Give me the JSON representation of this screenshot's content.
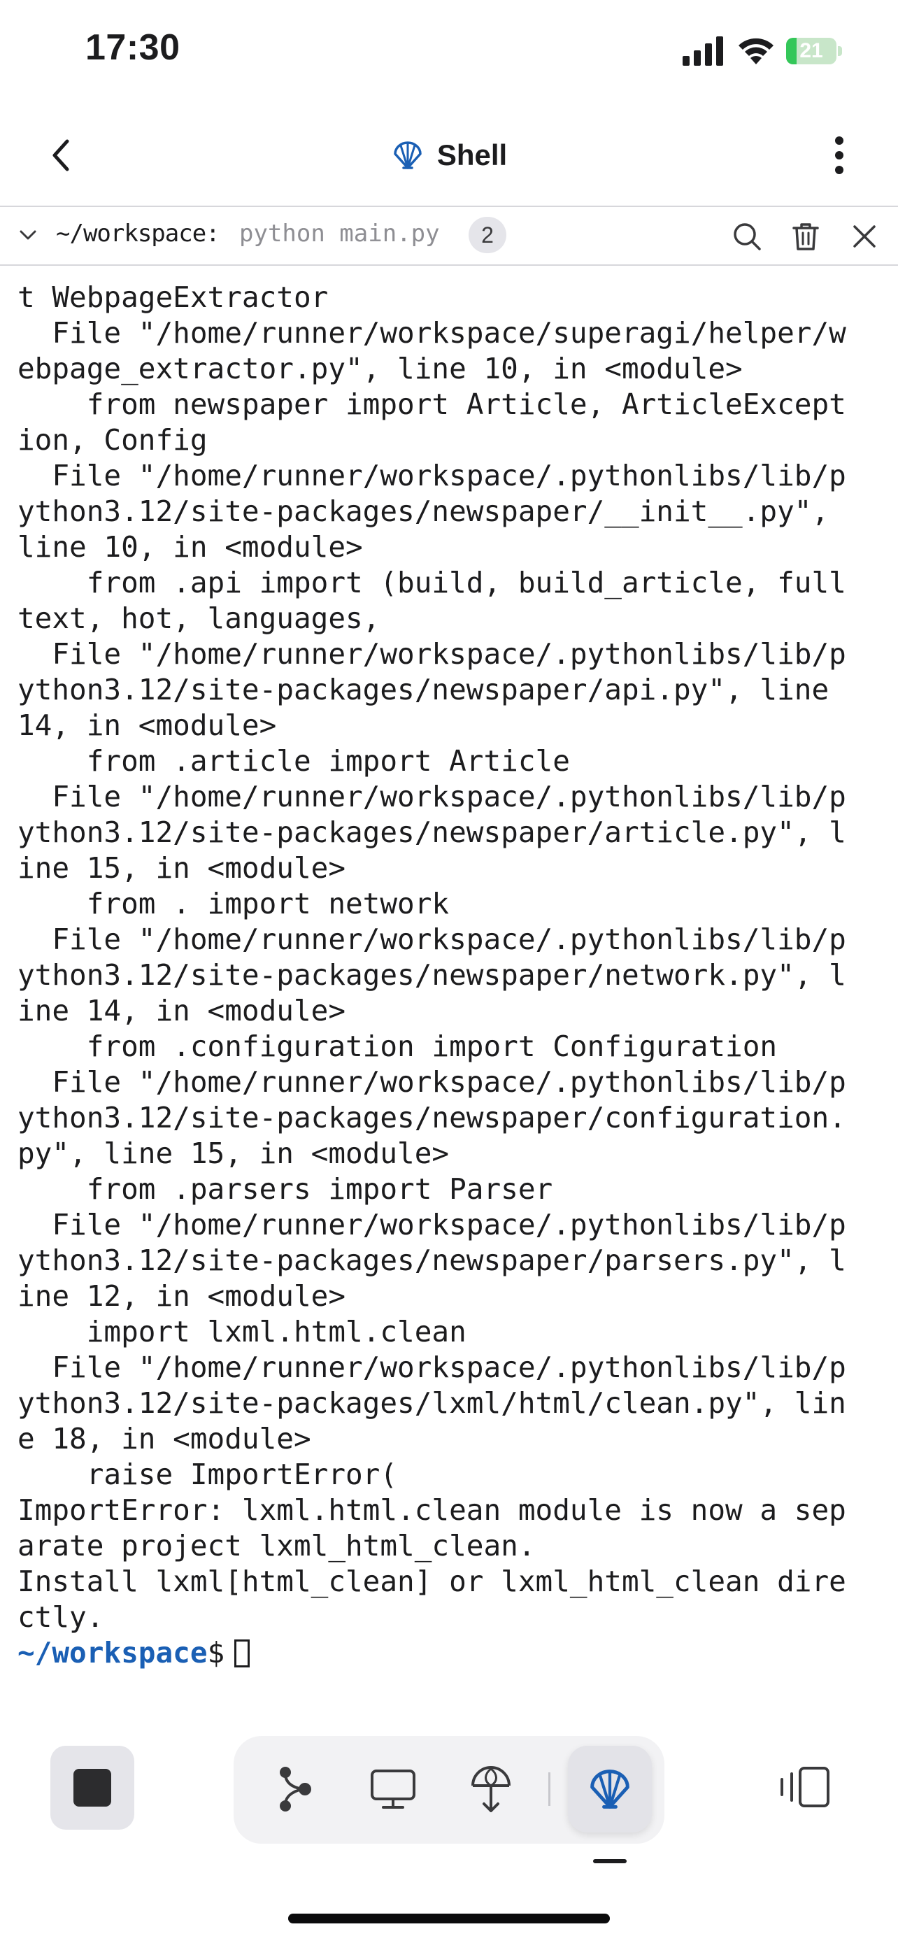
{
  "status_bar": {
    "time": "17:30",
    "battery_level": "21",
    "battery_fraction": 0.21
  },
  "header": {
    "title": "Shell",
    "back_icon": "chevron-left-icon",
    "more_icon": "more-vertical-icon",
    "logo_icon": "shell-icon"
  },
  "command_bar": {
    "path": "~/workspace:",
    "command": "python main.py",
    "count": "2"
  },
  "terminal": {
    "lines": [
      "t WebpageExtractor",
      "  File \"/home/runner/workspace/superagi/helper/w",
      "ebpage_extractor.py\", line 10, in <module>",
      "    from newspaper import Article, ArticleExcept",
      "ion, Config",
      "  File \"/home/runner/workspace/.pythonlibs/lib/p",
      "ython3.12/site-packages/newspaper/__init__.py\",",
      "line 10, in <module>",
      "    from .api import (build, build_article, full",
      "text, hot, languages,",
      "  File \"/home/runner/workspace/.pythonlibs/lib/p",
      "ython3.12/site-packages/newspaper/api.py\", line",
      "14, in <module>",
      "    from .article import Article",
      "  File \"/home/runner/workspace/.pythonlibs/lib/p",
      "ython3.12/site-packages/newspaper/article.py\", l",
      "ine 15, in <module>",
      "    from . import network",
      "  File \"/home/runner/workspace/.pythonlibs/lib/p",
      "ython3.12/site-packages/newspaper/network.py\", l",
      "ine 14, in <module>",
      "    from .configuration import Configuration",
      "  File \"/home/runner/workspace/.pythonlibs/lib/p",
      "ython3.12/site-packages/newspaper/configuration.",
      "py\", line 15, in <module>",
      "    from .parsers import Parser",
      "  File \"/home/runner/workspace/.pythonlibs/lib/p",
      "ython3.12/site-packages/newspaper/parsers.py\", l",
      "ine 12, in <module>",
      "    import lxml.html.clean",
      "  File \"/home/runner/workspace/.pythonlibs/lib/p",
      "ython3.12/site-packages/lxml/html/clean.py\", lin",
      "e 18, in <module>",
      "    raise ImportError(",
      "ImportError: lxml.html.clean module is now a sep",
      "arate project lxml_html_clean.",
      "Install lxml[html_clean] or lxml_html_clean dire",
      "ctly."
    ],
    "prompt_path": "~/workspace",
    "prompt_symbol": "$"
  },
  "toolbar": {
    "stop_icon": "stop-icon",
    "tabs": [
      {
        "icon": "git-graph-icon",
        "active": false
      },
      {
        "icon": "monitor-icon",
        "active": false
      },
      {
        "icon": "deploy-icon",
        "active": false
      },
      {
        "icon": "shell-icon",
        "active": true
      }
    ],
    "panel_icon": "panel-switch-icon"
  },
  "colors": {
    "accent_blue": "#1a5fb4",
    "prompt_blue": "#1a5fb4",
    "battery_green": "#34c759",
    "text": "#1c1c1e",
    "muted": "#8e8e93"
  }
}
